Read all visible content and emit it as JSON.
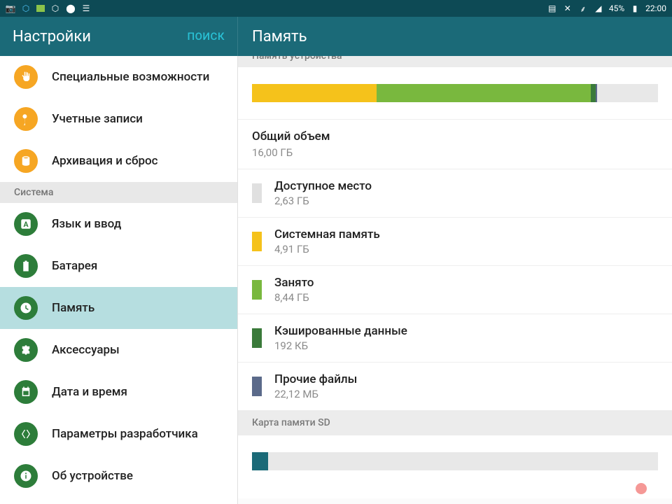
{
  "status": {
    "battery": "45%",
    "time": "22:00"
  },
  "header": {
    "settings_title": "Настройки",
    "search": "ПОИСК",
    "screen_title": "Память"
  },
  "sidebar": {
    "items_top": [
      {
        "label": "Специальные возможности",
        "icon": "hand",
        "color": "ic-orange"
      },
      {
        "label": "Учетные записи",
        "icon": "key",
        "color": "ic-orange"
      },
      {
        "label": "Архивация и сброс",
        "icon": "refresh-db",
        "color": "ic-orange"
      }
    ],
    "section_label": "Система",
    "items_system": [
      {
        "label": "Язык и ввод",
        "icon": "letter-a",
        "color": "ic-green",
        "selected": false
      },
      {
        "label": "Батарея",
        "icon": "battery",
        "color": "ic-green",
        "selected": false
      },
      {
        "label": "Память",
        "icon": "storage-clock",
        "color": "ic-green",
        "selected": true
      },
      {
        "label": "Аксессуары",
        "icon": "puzzle",
        "color": "ic-green",
        "selected": false
      },
      {
        "label": "Дата и время",
        "icon": "calendar",
        "color": "ic-green",
        "selected": false
      },
      {
        "label": "Параметры разработчика",
        "icon": "dev",
        "color": "ic-green",
        "selected": false
      },
      {
        "label": "Об устройстве",
        "icon": "info",
        "color": "ic-green",
        "selected": false
      }
    ]
  },
  "content": {
    "device_storage_header": "Память устройства",
    "segments": [
      {
        "color": "#f5c21b",
        "width": "30.7%"
      },
      {
        "color": "#79b83e",
        "width": "52.8%"
      },
      {
        "color": "#3a7a3a",
        "width": "1.2%"
      },
      {
        "color": "#5b6a8a",
        "width": "0.3%"
      }
    ],
    "total_label": "Общий объем",
    "total_value": "16,00 ГБ",
    "rows": [
      {
        "title": "Доступное место",
        "sub": "2,63 ГБ",
        "color": "#e0e0e0"
      },
      {
        "title": "Системная память",
        "sub": "4,91 ГБ",
        "color": "#f5c21b"
      },
      {
        "title": "Занято",
        "sub": "8,44 ГБ",
        "color": "#79b83e"
      },
      {
        "title": "Кэшированные данные",
        "sub": "192 КБ",
        "color": "#3a7a3a"
      },
      {
        "title": "Прочие файлы",
        "sub": "22,12 МБ",
        "color": "#5b6a8a"
      }
    ],
    "sd_header": "Карта памяти SD",
    "sd_segments": [
      {
        "color": "#1b6a78",
        "width": "4%"
      }
    ]
  }
}
